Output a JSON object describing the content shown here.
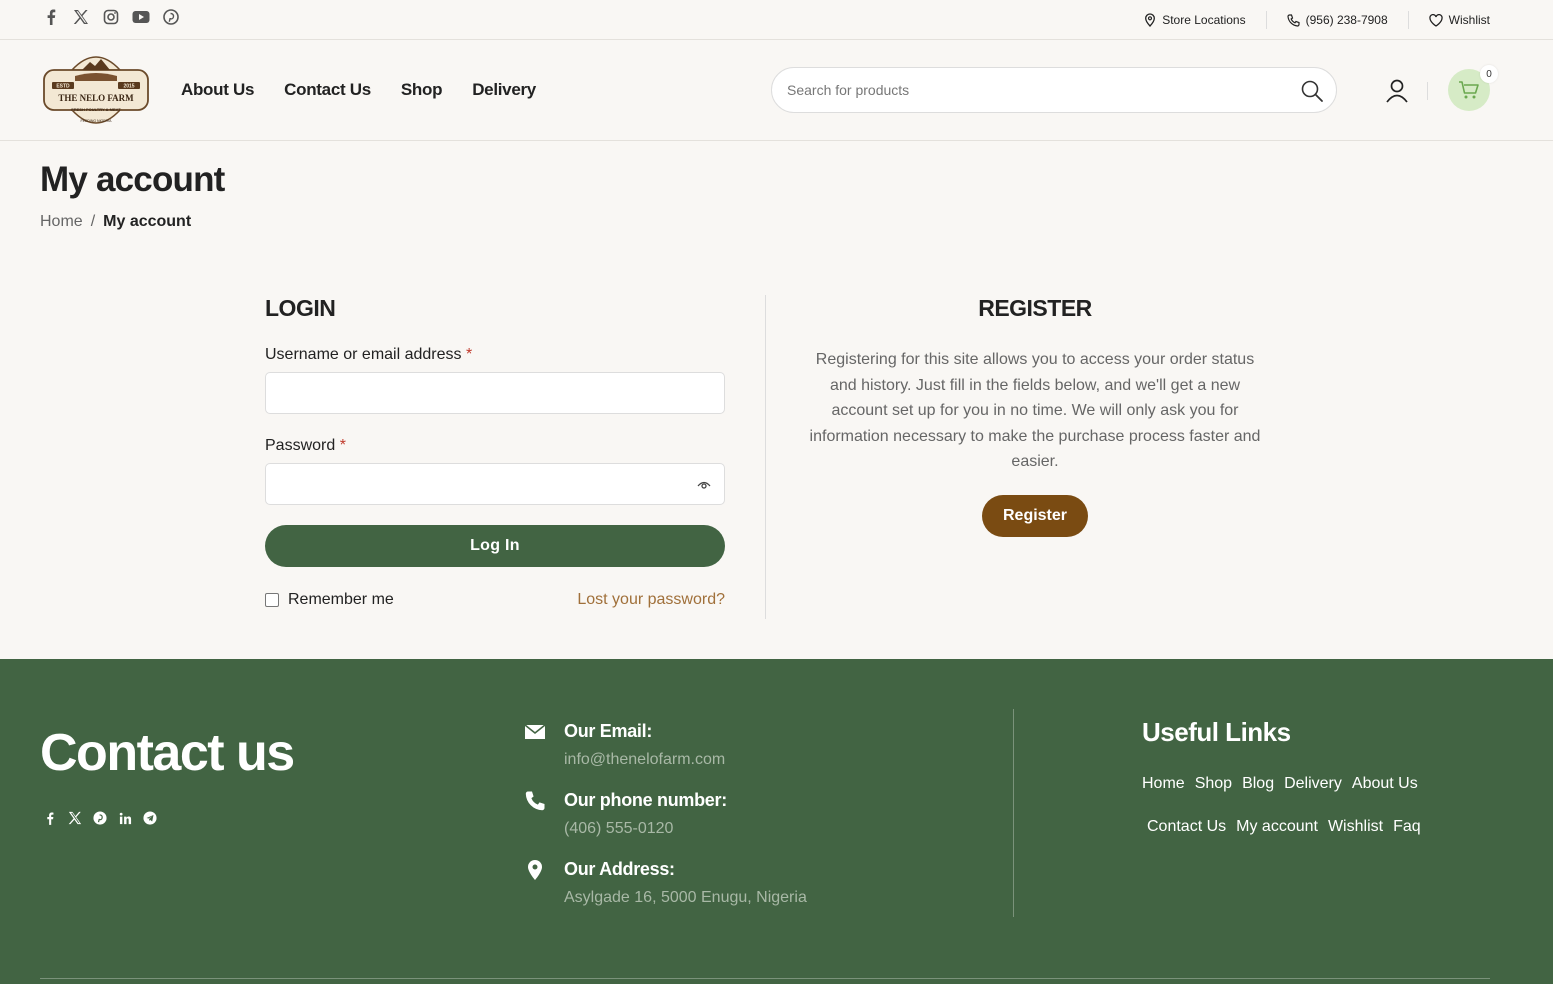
{
  "topbar": {
    "socials": [
      "facebook-icon",
      "x-icon",
      "instagram-icon",
      "youtube-icon",
      "pinterest-icon"
    ],
    "store_locations": "Store Locations",
    "phone": "(956) 238-7908",
    "wishlist": "Wishlist"
  },
  "header": {
    "logo": {
      "estd": "ESTD",
      "year": "2015",
      "name": "THE NELO FARM",
      "tagline": "FRESH POULTRY & MEAT",
      "footer": "FEEDING NIGERIA"
    },
    "nav": [
      "About Us",
      "Contact Us",
      "Shop",
      "Delivery"
    ],
    "search_placeholder": "Search for products",
    "cart_count": "0"
  },
  "page": {
    "title": "My account",
    "breadcrumb": {
      "home": "Home",
      "separator": "/",
      "current": "My account"
    }
  },
  "login": {
    "title": "LOGIN",
    "username_label": "Username or email address",
    "password_label": "Password",
    "required_mark": "*",
    "username_value": "",
    "password_value": "",
    "button": "Log In",
    "remember": "Remember me",
    "lost_password": "Lost your password?"
  },
  "register": {
    "title": "REGISTER",
    "text": "Registering for this site allows you to access your order status and history. Just fill in the fields below, and we'll get a new account set up for you in no time. We will only ask you for information necessary to make the purchase process faster and easier.",
    "button": "Register"
  },
  "footer": {
    "title": "Contact us",
    "socials": [
      "facebook-icon",
      "x-icon",
      "pinterest-icon",
      "linkedin-icon",
      "telegram-icon"
    ],
    "email_label": "Our Email:",
    "email": "info@thenelofarm.com",
    "phone_label": "Our phone number:",
    "phone": "(406) 555-0120",
    "address_label": "Our Address:",
    "address": "Asylgade 16, 5000 Enugu, Nigeria",
    "links_title": "Useful Links",
    "links": [
      "Home",
      "Shop",
      "Blog",
      "Delivery",
      "About Us",
      "Contact Us",
      "My account",
      "Wishlist",
      "Faq"
    ]
  },
  "colors": {
    "green": "#426443",
    "brown": "#7a4b12",
    "link": "#a0703a",
    "cart_bg": "#d6ebc6"
  }
}
